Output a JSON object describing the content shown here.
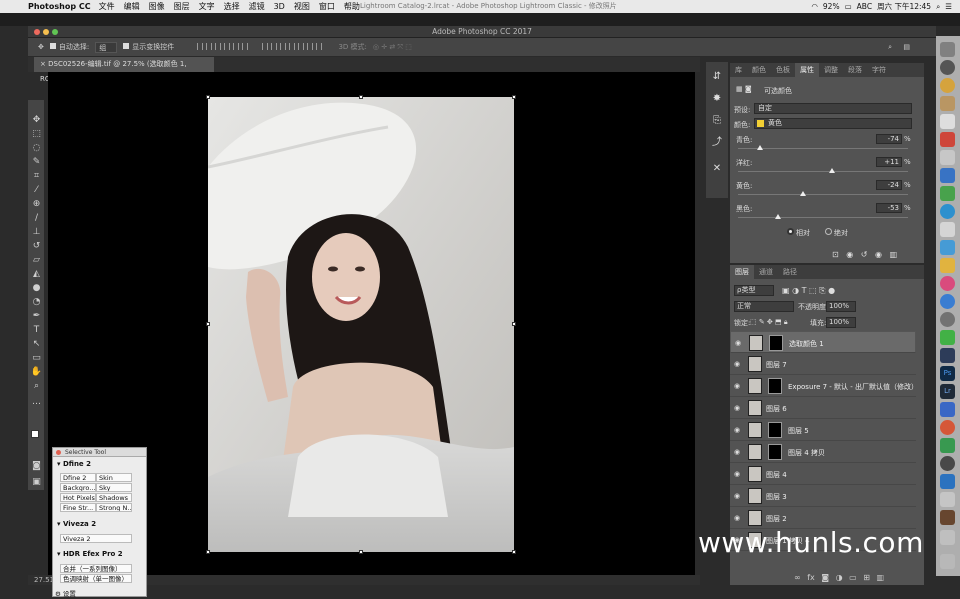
{
  "menubar": {
    "app": "Photoshop CC",
    "items": [
      "文件",
      "编辑",
      "图像",
      "图层",
      "文字",
      "选择",
      "滤镜",
      "3D",
      "视图",
      "窗口",
      "帮助"
    ],
    "lr_title": "Lightroom Catalog-2.lrcat - Adobe Photoshop Lightroom Classic - 修改照片",
    "battery": "92%",
    "input": "ABC",
    "clock": "周六 下午12:45"
  },
  "window": {
    "title": "Adobe Photoshop CC 2017"
  },
  "options": {
    "auto_select_label": "自动选择:",
    "auto_select_value": "组",
    "show_transform_label": "显示变换控件",
    "mode3d_label": "3D 模式:"
  },
  "doc": {
    "tab_label": "DSC02526-编辑.tif @ 27.5% (选取颜色 1, RGB/16) *"
  },
  "status": {
    "zoom": "27.51%"
  },
  "props": {
    "tabs": [
      "库",
      "颜色",
      "色板",
      "属性",
      "调整",
      "段落",
      "字符"
    ],
    "title": "可选颜色",
    "preset_label": "预设:",
    "preset_value": "自定",
    "colors_label": "颜色:",
    "colors_value": "黄色",
    "sliders": [
      {
        "label": "青色:",
        "value": "-74",
        "level": 0.13
      },
      {
        "label": "洋红:",
        "value": "+11",
        "level": 0.555
      },
      {
        "label": "黄色:",
        "value": "-24",
        "level": 0.38
      },
      {
        "label": "黑色:",
        "value": "-53",
        "level": 0.235
      }
    ],
    "unit": "%",
    "relative": "相对",
    "absolute": "绝对"
  },
  "layers": {
    "tabs": [
      "图层",
      "通道",
      "路径"
    ],
    "filter_label": "ρ类型",
    "blend_mode": "正常",
    "opacity_label": "不透明度:",
    "opacity_value": "100%",
    "lock_label": "锁定:",
    "fill_label": "填充:",
    "fill_value": "100%",
    "items": [
      {
        "name": "选取颜色 1",
        "selected": true,
        "mask": true
      },
      {
        "name": "图层 7",
        "selected": false,
        "mask": false
      },
      {
        "name": "Exposure 7 - 默认 - 出厂默认值（修改）",
        "selected": false,
        "mask": true
      },
      {
        "name": "图层 6",
        "selected": false,
        "mask": false
      },
      {
        "name": "图层 5",
        "selected": false,
        "mask": true
      },
      {
        "name": "图层 4 拷贝",
        "selected": false,
        "mask": true
      },
      {
        "name": "图层 4",
        "selected": false,
        "mask": false
      },
      {
        "name": "图层 3",
        "selected": false,
        "mask": false
      },
      {
        "name": "图层 2",
        "selected": false,
        "mask": false
      },
      {
        "name": "图层 1 拷贝 4",
        "selected": false,
        "mask": false
      }
    ]
  },
  "selective_tool": {
    "title": "Selective Tool",
    "dfine_header": "Dfine 2",
    "dfine_cells": [
      "Dfine 2",
      "Skin",
      "Backgro...",
      "Sky",
      "Hot Pixels",
      "Shadows",
      "Fine Str...",
      "Strong N..."
    ],
    "viveza_header": "Viveza 2",
    "viveza_cell": "Viveza 2",
    "hdr_header": "HDR Efex Pro 2",
    "hdr_cells": [
      "合并（一系列图像）",
      "色调映射（单一图像）"
    ],
    "settings": "设置"
  },
  "watermark": "www.hunls.com"
}
